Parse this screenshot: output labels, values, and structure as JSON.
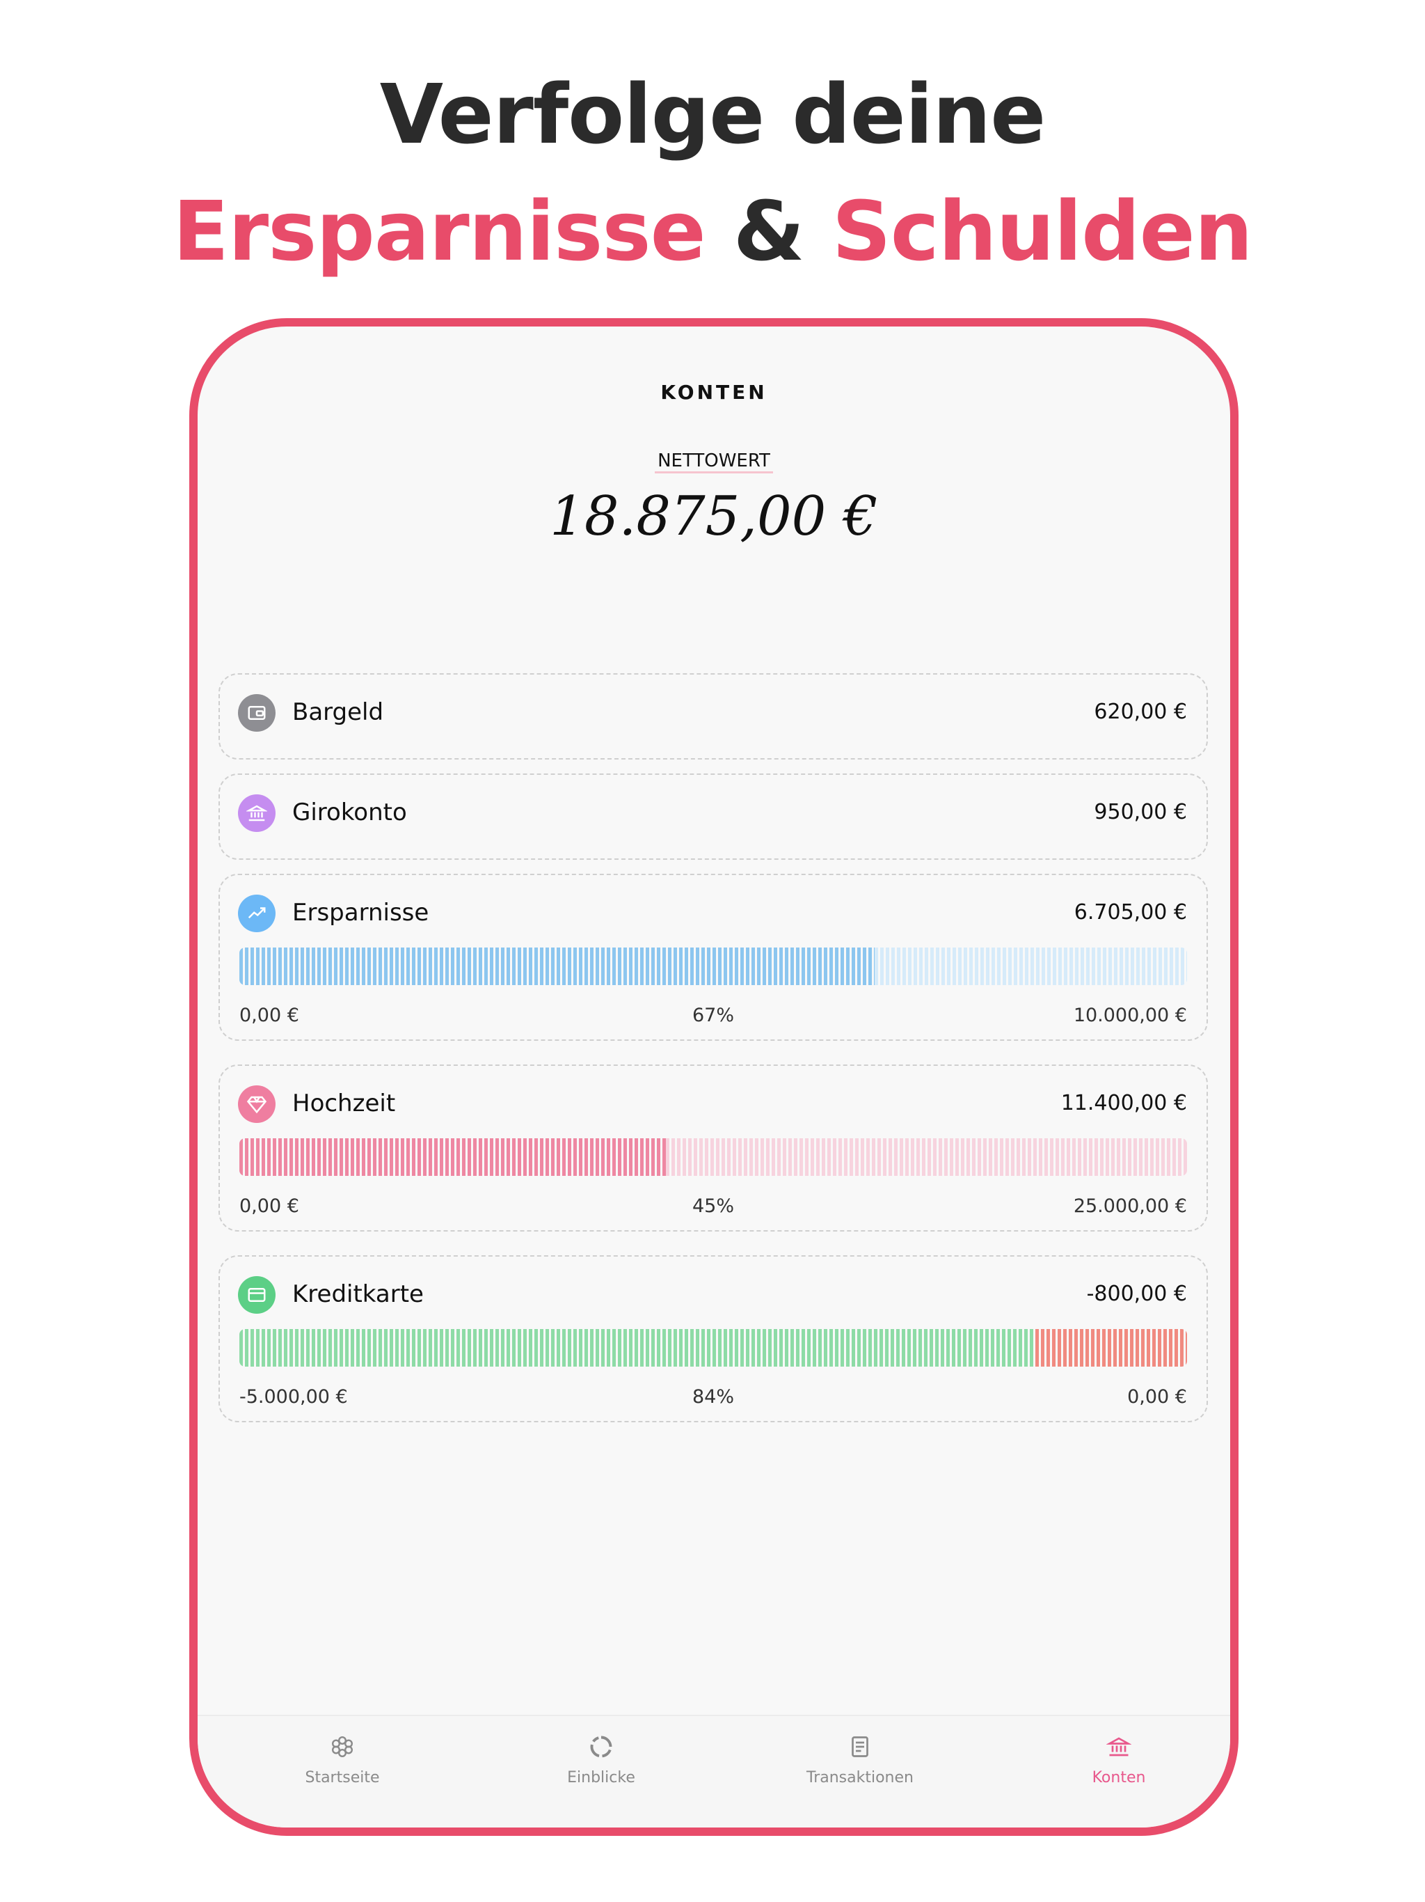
{
  "headline": {
    "line1": "Verfolge deine",
    "word_savings": "Ersparnisse",
    "ampersand": "&",
    "word_debts": "Schulden"
  },
  "screen": {
    "title": "KONTEN",
    "networth_label": "NETTOWERT",
    "networth_value": "18.875,00 €"
  },
  "accounts": [
    {
      "name": "Bargeld",
      "amount": "620,00 €",
      "icon": "wallet-icon",
      "color": "#8e8e93"
    },
    {
      "name": "Girokonto",
      "amount": "950,00 €",
      "icon": "bank-icon",
      "color": "#c58df0"
    },
    {
      "name": "Ersparnisse",
      "amount": "6.705,00 €",
      "icon": "trend-icon",
      "color": "#6cb8f6",
      "progress": {
        "min": "0,00 €",
        "percent_label": "67%",
        "max": "10.000,00 €",
        "fraction": 0.67,
        "fill_color": "#8cc6ef",
        "rest_color": "#d6ebfa"
      }
    },
    {
      "name": "Hochzeit",
      "amount": "11.400,00 €",
      "icon": "diamond-icon",
      "color": "#ef7ea0",
      "progress": {
        "min": "0,00 €",
        "percent_label": "45%",
        "max": "25.000,00 €",
        "fraction": 0.45,
        "fill_color": "#ee87a2",
        "rest_color": "#f7d3de"
      }
    },
    {
      "name": "Kreditkarte",
      "amount": "-800,00 €",
      "icon": "credit-card-icon",
      "color": "#5ccf86",
      "progress": {
        "min": "-5.000,00 €",
        "percent_label": "84%",
        "max": "0,00 €",
        "fraction": 0.84,
        "fill_color": "#8ddba6",
        "rest_color": "#f08a80"
      }
    }
  ],
  "tabs": [
    {
      "label": "Startseite",
      "icon": "flower-icon",
      "active": false
    },
    {
      "label": "Einblicke",
      "icon": "ring-chart-icon",
      "active": false
    },
    {
      "label": "Transaktionen",
      "icon": "receipt-icon",
      "active": false
    },
    {
      "label": "Konten",
      "icon": "bank-icon",
      "active": true
    }
  ],
  "colors": {
    "accent": "#e84c6a",
    "headline_dark": "#2b2b2b",
    "active_tab": "#e8588c"
  }
}
